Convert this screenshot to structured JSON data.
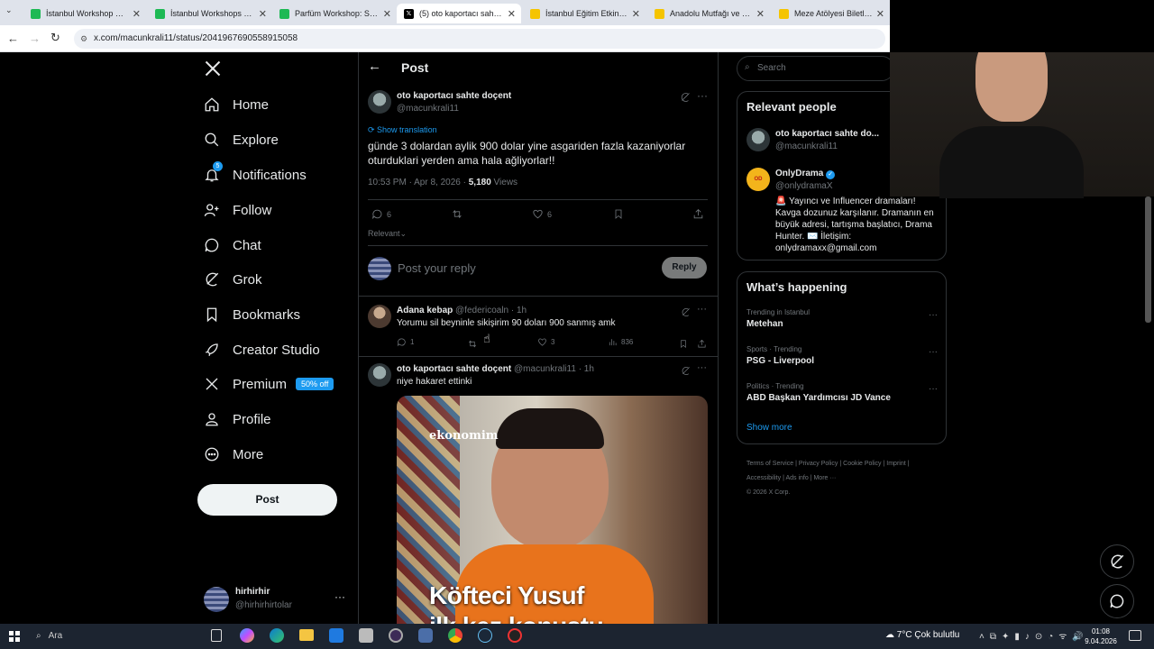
{
  "browser": {
    "tabs": [
      {
        "title": "İstanbul Workshop Etkinlik",
        "fav": "#1db954",
        "active": false
      },
      {
        "title": "İstanbul Workshops Deri",
        "fav": "#1db954",
        "active": false
      },
      {
        "title": "Parfüm Workshop: Sosyal",
        "fav": "#1db954",
        "active": false
      },
      {
        "title": "(5) oto kaportacı sahte do",
        "fav": "#000000",
        "active": true
      },
      {
        "title": "İstanbul Eğitim Etkinlikler",
        "fav": "#f5c400",
        "active": false
      },
      {
        "title": "Anadolu Mutfağı ve Yeme",
        "fav": "#f5c400",
        "active": false
      },
      {
        "title": "Meze Atölyesi Biletleri | b",
        "fav": "#f5c400",
        "active": false
      }
    ],
    "url": "x.com/macunkrali11/status/2041967690558915058"
  },
  "nav": {
    "items": [
      {
        "label": "Home",
        "icon": "home-icon"
      },
      {
        "label": "Explore",
        "icon": "search-icon"
      },
      {
        "label": "Notifications",
        "icon": "bell-icon",
        "badge": "5"
      },
      {
        "label": "Follow",
        "icon": "follow-icon"
      },
      {
        "label": "Chat",
        "icon": "chat-icon"
      },
      {
        "label": "Grok",
        "icon": "grok-icon"
      },
      {
        "label": "Bookmarks",
        "icon": "bookmark-icon"
      },
      {
        "label": "Creator Studio",
        "icon": "rocket-icon"
      },
      {
        "label": "Premium",
        "icon": "x-logo-icon",
        "badge": "50% off"
      },
      {
        "label": "Profile",
        "icon": "person-icon"
      },
      {
        "label": "More",
        "icon": "more-circle-icon"
      }
    ],
    "post_button": "Post",
    "account": {
      "name": "hirhirhir",
      "handle": "@hirhirhirtolar"
    }
  },
  "header": {
    "title": "Post"
  },
  "post": {
    "author": "oto kaportacı sahte doçent",
    "handle": "@macunkrali11",
    "show_translation": "Show translation",
    "text": "günde 3 dolardan aylik 900 dolar yine asgariden fazla kazaniyorlar oturduklari yerden ama hala ağliyorlar!!",
    "time": "10:53 PM · Apr 8, 2026 · ",
    "views": "5,180",
    "views_label": " Views",
    "replies": "6",
    "likes": "6",
    "sort": "Relevant"
  },
  "reply_box": {
    "placeholder": "Post your reply",
    "button": "Reply"
  },
  "replies": [
    {
      "author": "Adana kebap",
      "handle": "@federicoaln · 1h",
      "text": "Yorumu sil beyninle sikişirim 90 doları 900 sanmış amk",
      "replies": "1",
      "likes": "3",
      "views": "836"
    },
    {
      "author": "oto kaportacı sahte doçent",
      "handle": "@macunkrali11 · 1h",
      "text": "niye hakaret ettinki",
      "image_brand": "ekonomim",
      "image_caption": "Köfteci Yusuf",
      "image_caption2": "ilk kez konuştu"
    }
  ],
  "search": {
    "placeholder": "Search"
  },
  "relevant": {
    "title": "Relevant people",
    "people": [
      {
        "name": "oto kaportacı sahte do...",
        "handle": "@macunkrali11"
      },
      {
        "name": "OnlyDrama",
        "handle": "@onlydramaX",
        "bio": "🚨 Yayıncı ve Influencer dramaları! Kavga dozunuz karşılanır. Dramanın en büyük adresi, tartışma başlatıcı, Drama Hunter. ✉️ İletişim: onlydramaxx@gmail.com"
      }
    ]
  },
  "happening": {
    "title": "What’s happening",
    "trends": [
      {
        "context": "Trending in Istanbul",
        "name": "Metehan"
      },
      {
        "context": "Sports · Trending",
        "name": "PSG - Liverpool"
      },
      {
        "context": "Politics · Trending",
        "name": "ABD Başkan Yardımcısı JD Vance"
      }
    ],
    "show_more": "Show more"
  },
  "footer": {
    "links": [
      "Terms of Service",
      "Privacy Policy",
      "Cookie Policy",
      "Imprint",
      "Accessibility",
      "Ads info",
      "More ···"
    ],
    "copyright": "© 2026 X Corp."
  },
  "taskbar": {
    "search": "Ara",
    "weather": "7°C  Çok bulutlu",
    "time": "01:08",
    "date": "9.04.2026"
  },
  "colors": {
    "accent": "#1d9bf0",
    "background": "#000000",
    "border": "#2f3336",
    "muted": "#71767b"
  }
}
